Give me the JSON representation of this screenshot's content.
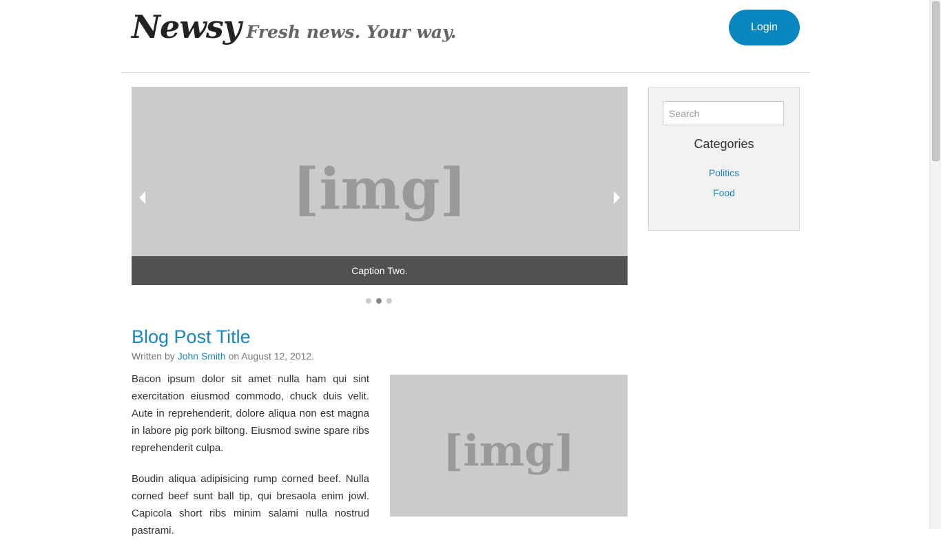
{
  "header": {
    "brand_name": "Newsy",
    "tagline": "Fresh news. Your way.",
    "login_label": "Login"
  },
  "slider": {
    "image_placeholder": "[img]",
    "caption": "Caption Two.",
    "slide_count": 3,
    "active_slide_index": 2
  },
  "sidebar": {
    "search_placeholder": "Search",
    "categories_title": "Categories",
    "categories": [
      {
        "label": "Politics"
      },
      {
        "label": "Food"
      }
    ]
  },
  "post": {
    "title": "Blog Post Title",
    "byline_prefix": "Written by",
    "author": "John Smith",
    "byline_suffix": "on August 12, 2012.",
    "image_placeholder": "[img]",
    "paragraphs": [
      "Bacon ipsum dolor sit amet nulla ham qui sint exercitation eiusmod commodo, chuck duis velit. Aute in reprehenderit, dolore aliqua non est magna in labore pig pork biltong. Eiusmod swine spare ribs reprehenderit culpa.",
      "Boudin aliqua adipisicing rump corned beef. Nulla corned beef sunt ball tip, qui bresaola enim jowl. Capicola short ribs minim salami nulla nostrud pastrami."
    ]
  },
  "colors": {
    "accent": "#0a87be",
    "link": "#1a85bd",
    "caption_bar": "#515151",
    "placeholder_bg": "#cbcbcb"
  },
  "icons": {
    "prev": "chevron-left-icon",
    "next": "chevron-right-icon"
  }
}
